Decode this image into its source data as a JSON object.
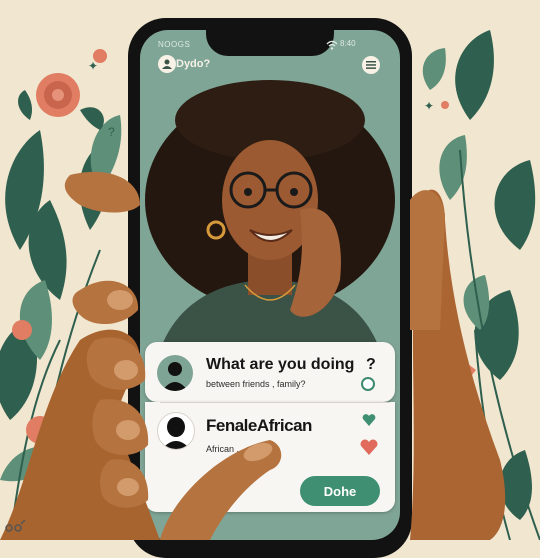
{
  "status_bar": {
    "carrier": "NOOGS",
    "time": "8:40"
  },
  "app": {
    "name": "Dydo?"
  },
  "card_1": {
    "title": "What are you doing",
    "question_mark": "?",
    "subtitle": "between friends , family?"
  },
  "card_2": {
    "title": "FenaleAfrican",
    "subtitle": "African ... moring?"
  },
  "done_button": {
    "label": "Dohe"
  },
  "colors": {
    "accent": "#3f8f73",
    "screen_bg": "#7fa596",
    "card_bg": "#f8f6f2",
    "heart_red": "#e06a5c",
    "skin": "#b5733f"
  },
  "icons": [
    "wifi-icon",
    "menu-icon",
    "avatar-silhouette-icon",
    "heart-icon",
    "radio-icon"
  ]
}
